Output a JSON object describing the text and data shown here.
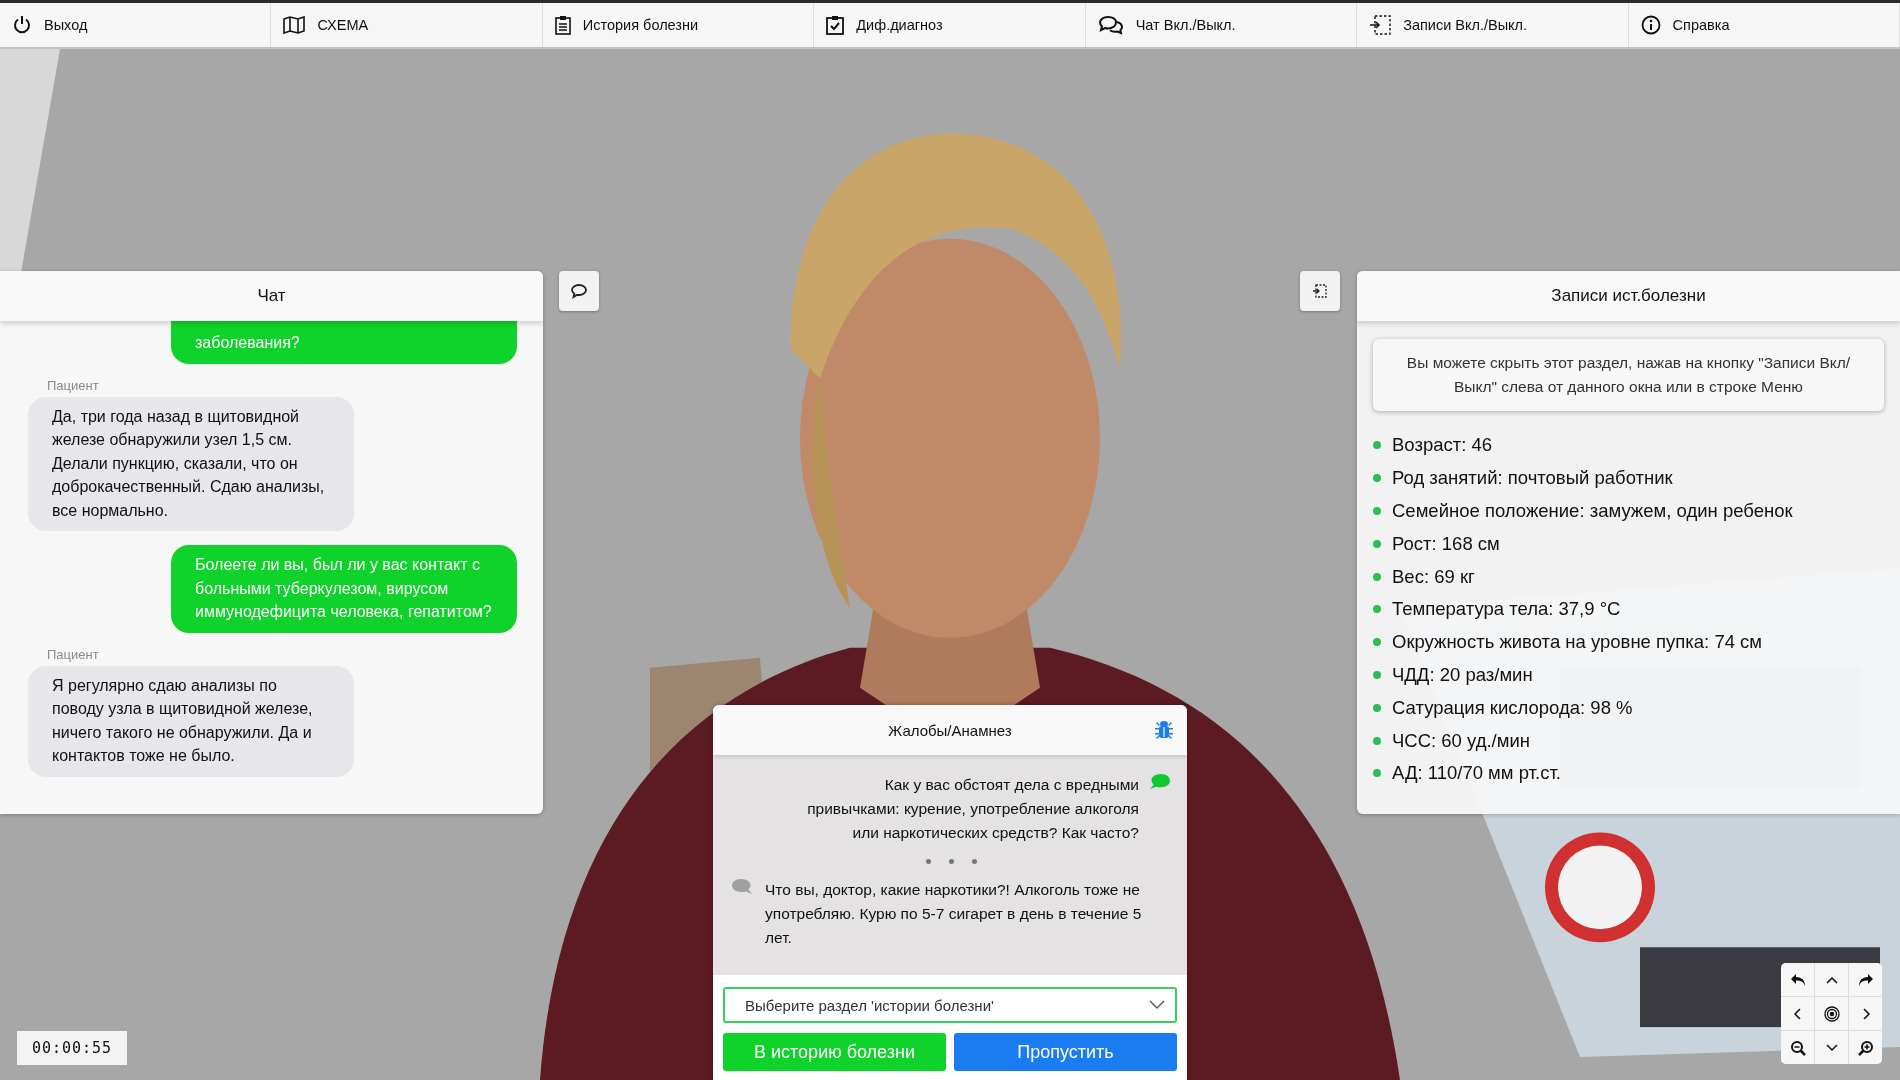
{
  "menu": [
    {
      "label": "Выход"
    },
    {
      "label": "СХЕМА"
    },
    {
      "label": "История болезни"
    },
    {
      "label": "Диф.диагноз"
    },
    {
      "label": "Чат Вкл./Выкл."
    },
    {
      "label": "Записи Вкл./Выкл."
    },
    {
      "label": "Справка"
    }
  ],
  "chat": {
    "title": "Чат",
    "messages": [
      {
        "kind": "sent",
        "text": "заболевания?"
      },
      {
        "kind": "received",
        "sender": "Пациент",
        "text": "Да, три года назад в щитовидной железе обнаружили узел 1,5 см. Делали пункцию, сказали, что он доброкачественный. Сдаю анализы, все нормально."
      },
      {
        "kind": "sent",
        "text": "Болеете ли вы, был ли у вас контакт с больными туберкулезом, вирусом иммунодефицита человека, гепатитом?"
      },
      {
        "kind": "received",
        "sender": "Пациент",
        "text": "Я регулярно сдаю анализы по поводу узла в щитовидной железе, ничего такого не обнаружили. Да и контактов тоже не было."
      }
    ]
  },
  "records": {
    "title": "Записи ист.болезни",
    "hint": "Вы можете скрыть этот раздел, нажав на кнопку \"Записи Вкл/Выкл\" слева от данного окна или в строке Меню",
    "items": [
      "Возраст: 46",
      "Род занятий: почтовый работник",
      "Семейное положение: замужем, один ребенок",
      "Рост: 168 см",
      "Вес: 69 кг",
      "Температура тела: 37,9 °C",
      "Окружность живота на уровне пупка: 74 см",
      "ЧДД: 20 раз/мин",
      "Сатурация кислорода: 98 %",
      "ЧСС: 60 уд./мин",
      "АД: 110/70 мм рт.ст."
    ]
  },
  "dialog": {
    "title": "Жалобы/Анамнез",
    "question": "Как у вас обстоят дела с вредными привычками: курение, употребление алкоголя или наркотических средств? Как часто?",
    "answer": "Что вы, доктор, какие наркотики?! Алкоголь тоже не употребляю. Курю по 5-7 сигарет в день в течение 5 лет.",
    "select": {
      "placeholder": "Выберите раздел 'истории болезни'"
    },
    "buttons": [
      {
        "label": "В историю болезни",
        "kind": "primary"
      },
      {
        "label": "Пропустить",
        "kind": "secondary"
      }
    ]
  },
  "timer": "00:00:55"
}
